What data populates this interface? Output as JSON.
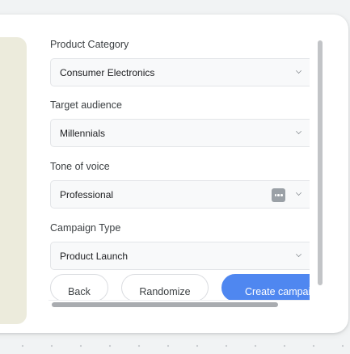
{
  "form": {
    "product_category": {
      "label": "Product Category",
      "value": "Consumer Electronics"
    },
    "target_audience": {
      "label": "Target audience",
      "value": "Millennials"
    },
    "tone_of_voice": {
      "label": "Tone of voice",
      "value": "Professional"
    },
    "campaign_type": {
      "label": "Campaign Type",
      "value": "Product Launch"
    }
  },
  "actions": {
    "back_label": "Back",
    "randomize_label": "Randomize",
    "create_label": "Create campaign"
  },
  "icons": {
    "dropdown": "chevron-down-icon",
    "more": "more-horiz-icon"
  },
  "colors": {
    "primary": "#4f87f0",
    "preview_bg": "#ecebdc"
  }
}
